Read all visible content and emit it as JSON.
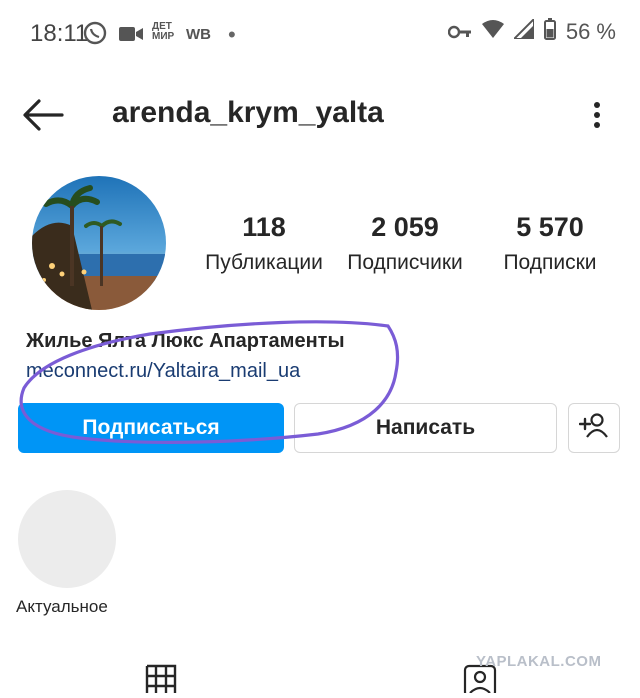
{
  "status_bar": {
    "time": "18:11",
    "wb": "WB",
    "battery_pct": "56 %",
    "detmir_line1": "ДЕТ",
    "detmir_line2": "МИР"
  },
  "header": {
    "username": "arenda_krym_yalta"
  },
  "profile": {
    "stats": [
      {
        "num": "118",
        "label": "Публикации"
      },
      {
        "num": "2 059",
        "label": "Подписчики"
      },
      {
        "num": "5 570",
        "label": "Подписки"
      }
    ],
    "bio_name": "Жилье Ялта Люкс Апартаменты",
    "bio_link": "meconnect.ru/Yaltaira_mail_ua"
  },
  "buttons": {
    "follow": "Подписаться",
    "message": "Написать"
  },
  "highlights": {
    "label": "Актуальное"
  },
  "watermark": "YAPLAKAL.COM",
  "colors": {
    "follow_blue": "#0095f6",
    "annotation_purple": "#7a5cd6"
  }
}
